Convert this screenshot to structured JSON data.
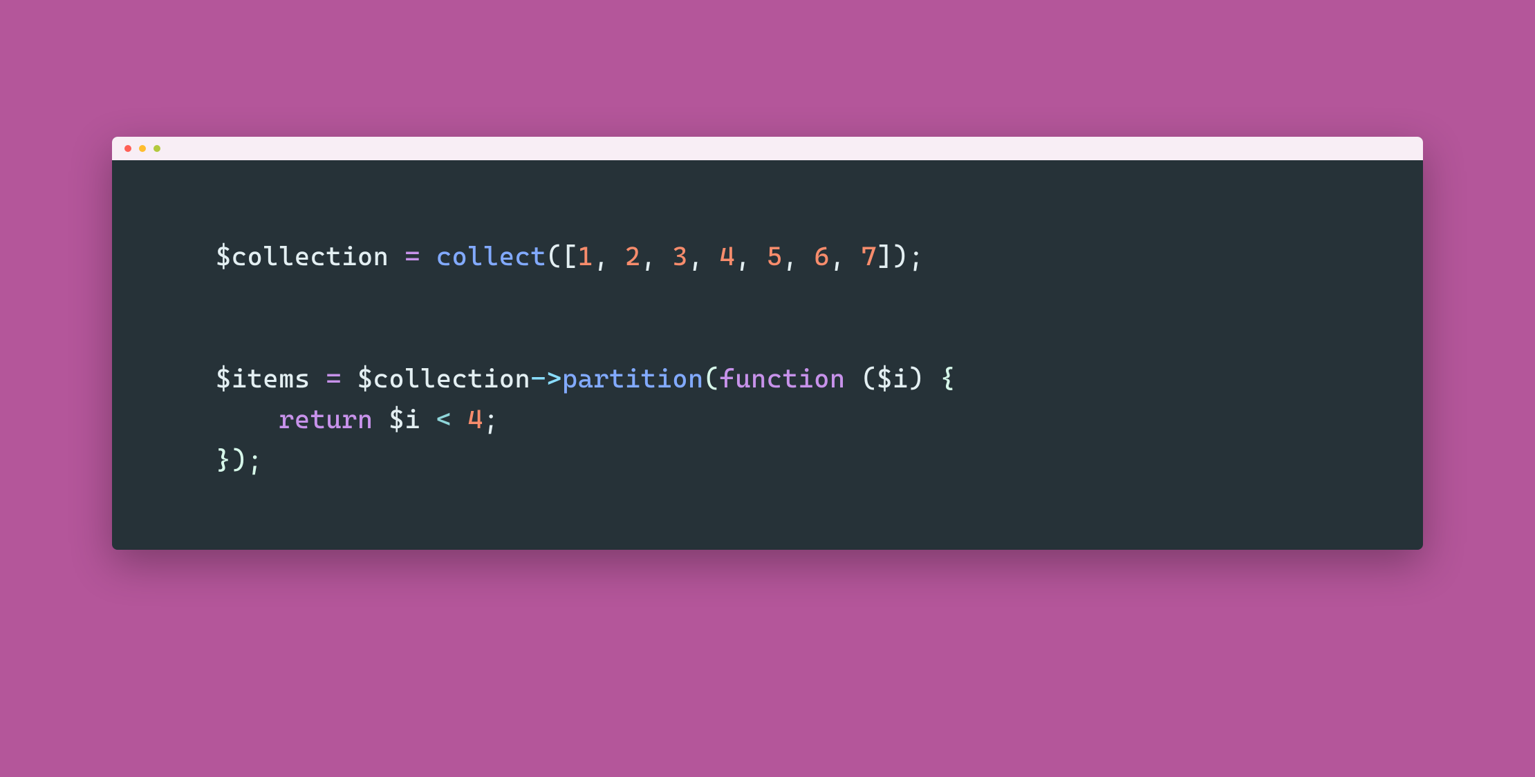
{
  "code": {
    "line1": {
      "var": "$collection",
      "assign": " = ",
      "func": "collect",
      "open": "([",
      "nums": [
        "1",
        "2",
        "3",
        "4",
        "5",
        "6",
        "7"
      ],
      "comma": ", ",
      "close": "]);"
    },
    "line2": {
      "var1": "$items",
      "assign": " = ",
      "var2": "$collection",
      "arrow": "->",
      "method": "partition",
      "open": "(",
      "kw": "function",
      "sp": " ",
      "parenOpen": "(",
      "param": "$i",
      "parenClose": ")",
      "sp2": " ",
      "brace": "{"
    },
    "line3": {
      "indent": "    ",
      "kw": "return",
      "sp": " ",
      "var": "$i",
      "sp2": " ",
      "op": "<",
      "sp3": " ",
      "num": "4",
      "semi": ";"
    },
    "line4": {
      "brace": "}",
      "close": ");"
    }
  }
}
